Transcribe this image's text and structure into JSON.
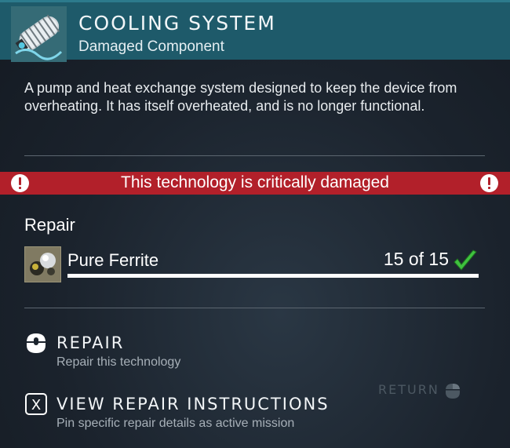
{
  "header": {
    "icon": "cooling-coil-icon",
    "title": "COOLING SYSTEM",
    "subtitle": "Damaged Component",
    "color": "#1e5a6a"
  },
  "description": "A pump and heat exchange system designed to keep the device from overheating. It has itself overheated, and is no longer functional.",
  "damage_banner": {
    "text": "This technology is critically damaged",
    "color": "#b2202a",
    "icon": "alert-icon"
  },
  "repair": {
    "heading": "Repair",
    "resources": [
      {
        "name": "Pure Ferrite",
        "count": "15 of 15",
        "progress": 1.0,
        "icon": "pure-ferrite-icon",
        "status_icon": "check-icon",
        "status_color": "#3fc23f"
      }
    ]
  },
  "actions": [
    {
      "label": "REPAIR",
      "description": "Repair this technology",
      "icon": "mouse-left-click-icon"
    },
    {
      "label": "VIEW REPAIR INSTRUCTIONS",
      "description": "Pin specific repair details as active mission",
      "icon": "x-key-icon",
      "key": "X"
    }
  ],
  "return_hint": {
    "label": "RETURN",
    "icon": "mouse-right-click-icon"
  }
}
